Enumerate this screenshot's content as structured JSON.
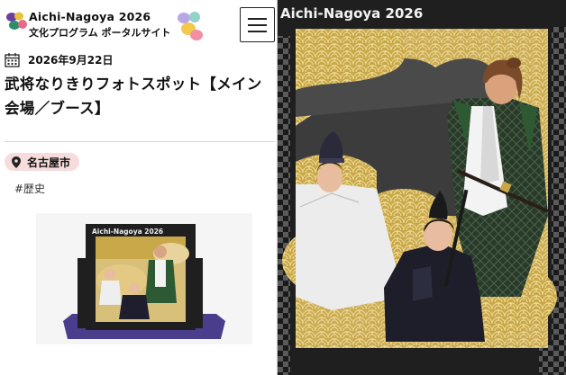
{
  "header": {
    "logo_title": "Aichi-Nagoya 2026",
    "logo_subtitle": "文化プログラム ポータルサイト",
    "menu_icon": "hamburger-menu-icon"
  },
  "event": {
    "date": "2026年9月22日",
    "title": "武将なりきりフォトスポット【メイン会場／ブース】",
    "location": "名古屋市",
    "tag": "#歴史"
  },
  "photo": {
    "frame_title": "Aichi-Nagoya 2026",
    "thumbnail_frame_title": "Aichi-Nagoya 2026"
  },
  "colors": {
    "badge_bg": "#f7dcdc",
    "frame_black": "#1f1f1f",
    "gold": "#c9a84a",
    "purple_floor": "#4a3d8c",
    "samurai_green": "#2e5a33"
  }
}
